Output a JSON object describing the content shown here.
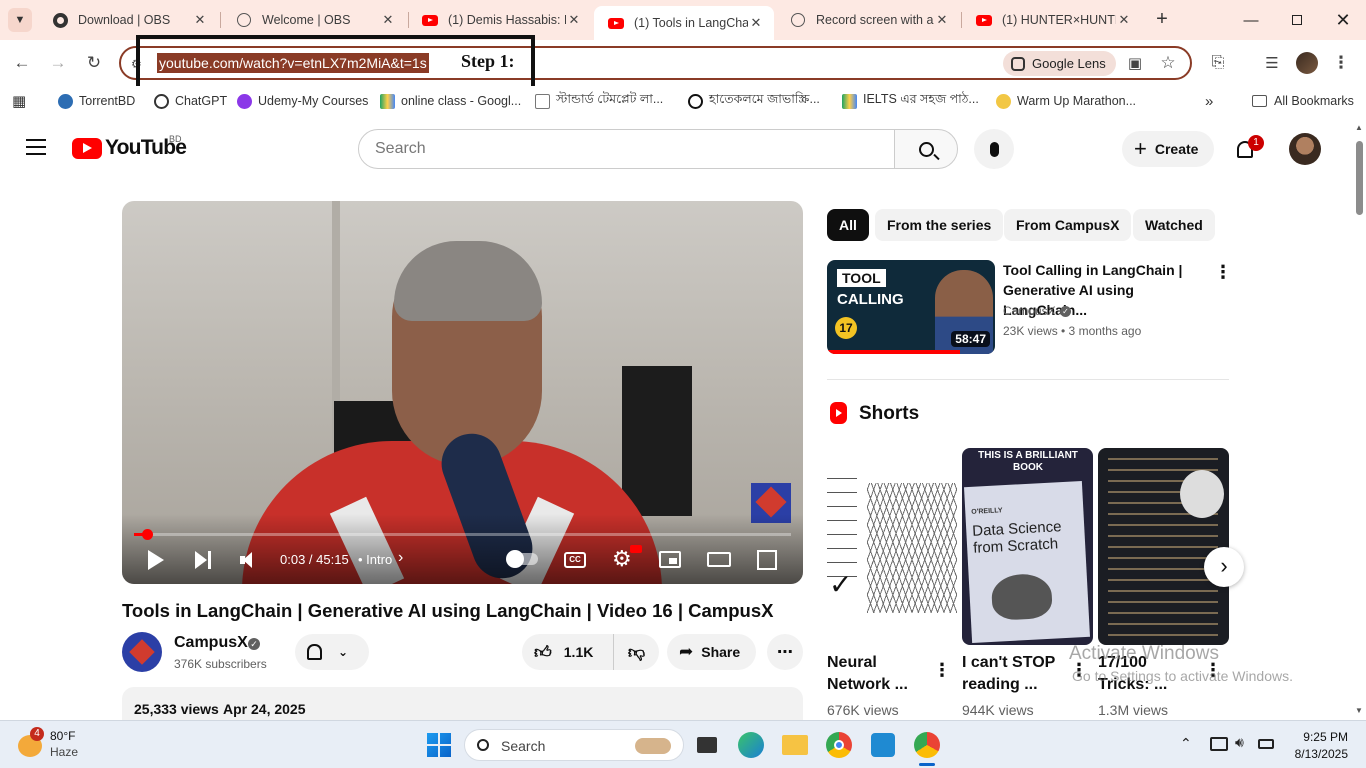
{
  "browser": {
    "tabs": [
      {
        "title": "Download | OBS",
        "icon": "obs-icon"
      },
      {
        "title": "Welcome | OBS",
        "icon": "globe-icon"
      },
      {
        "title": "(1) Demis Hassabis: D",
        "icon": "youtube-icon"
      },
      {
        "title": "(1) Tools in LangChai",
        "icon": "youtube-icon",
        "active": true
      },
      {
        "title": "Record screen with a",
        "icon": "globe-icon"
      },
      {
        "title": "(1) HUNTER×HUNTER",
        "icon": "youtube-icon"
      }
    ],
    "url": "youtube.com/watch?v=etnLX7m2MiA&t=1s",
    "annotation": "Step 1:",
    "lens_label": "Google Lens",
    "bookmarks": [
      "TorrentBD",
      "ChatGPT",
      "Udemy-My Courses",
      "online class - Googl...",
      "স্টান্ডার্ড টেমপ্লেট লা...",
      "হাতেকলমে জাভাস্ক্রি...",
      "IELTS এর সহজ পাঠ...",
      "Warm Up Marathon..."
    ],
    "all_bookmarks": "All Bookmarks"
  },
  "youtube": {
    "logo_text": "YouTube",
    "country": "BD",
    "search_placeholder": "Search",
    "create_label": "Create",
    "notification_count": "1",
    "player": {
      "time": "0:03 / 45:15",
      "chapter": "• Intro",
      "progress": 0.02
    },
    "video": {
      "title": "Tools in LangChain | Generative AI using LangChain | Video 16 | CampusX",
      "channel": "CampusX",
      "subscribers": "376K subscribers",
      "likes": "1.1K",
      "share": "Share",
      "views": "25,333 views",
      "date": "Apr 24, 2025"
    },
    "chips": [
      "All",
      "From the series",
      "From CampusX",
      "Watched"
    ],
    "recommended": {
      "title": "Tool Calling in LangChain | Generative AI using LangChain...",
      "channel": "CampusX",
      "stats": "23K views • 3 months ago",
      "duration": "58:47",
      "thumb_text_1": "TOOL",
      "thumb_text_2": "CALLING",
      "thumb_num": "17"
    },
    "shorts_label": "Shorts",
    "shorts": [
      {
        "title": "Neural Network ...",
        "views": "676K views"
      },
      {
        "title": "I can't STOP reading ...",
        "views": "944K views",
        "thumb_top": "THIS IS A BRILLIANT BOOK",
        "book_title": "Data Science from Scratch",
        "book_publisher": "O'REILLY"
      },
      {
        "title": "17/100 Tricks: ...",
        "views": "1.3M views"
      }
    ],
    "watermark_1": "Activate Windows",
    "watermark_2": "Go to Settings to activate Windows."
  },
  "taskbar": {
    "weather_temp": "80°F",
    "weather_desc": "Haze",
    "weather_badge": "4",
    "search": "Search",
    "time": "9:25 PM",
    "date": "8/13/2025"
  }
}
